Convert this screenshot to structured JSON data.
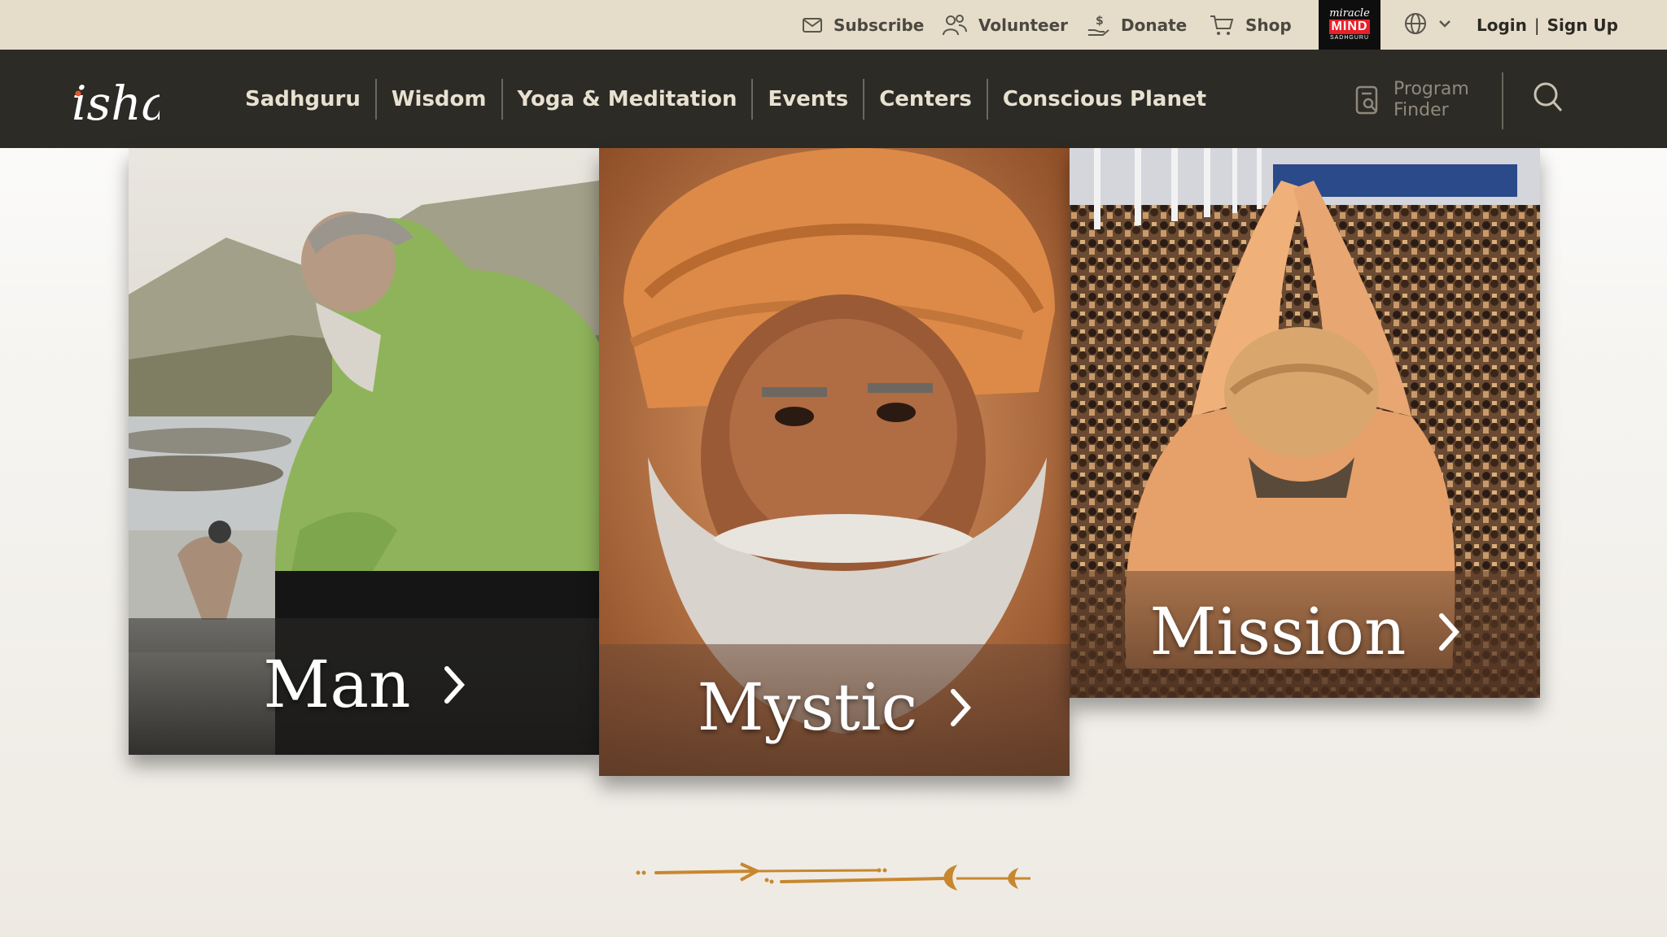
{
  "utility": {
    "items": [
      {
        "label": "Subscribe",
        "icon": "mail-icon"
      },
      {
        "label": "Volunteer",
        "icon": "people-icon"
      },
      {
        "label": "Donate",
        "icon": "donate-hand-icon"
      },
      {
        "label": "Shop",
        "icon": "cart-icon"
      }
    ],
    "miracle_mind_logo": {
      "line1": "miracle",
      "line2": "MIND",
      "line3": "SADHGURU"
    },
    "language_icon": "globe-icon",
    "login": "Login",
    "separator": "|",
    "signup": "Sign Up"
  },
  "nav": {
    "logo_text": "isha",
    "links": [
      "Sadhguru",
      "Wisdom",
      "Yoga & Meditation",
      "Events",
      "Centers",
      "Conscious Planet"
    ],
    "program_finder": {
      "line1": "Program",
      "line2": "Finder"
    },
    "search_icon": "search-icon"
  },
  "hero": {
    "cards": [
      {
        "label": "Man"
      },
      {
        "label": "Mystic"
      },
      {
        "label": "Mission"
      }
    ]
  },
  "colors": {
    "utility_bg": "#e5ddca",
    "nav_bg": "#2d2b26",
    "nav_text": "#e8e1d1",
    "accent": "#c8872e"
  }
}
